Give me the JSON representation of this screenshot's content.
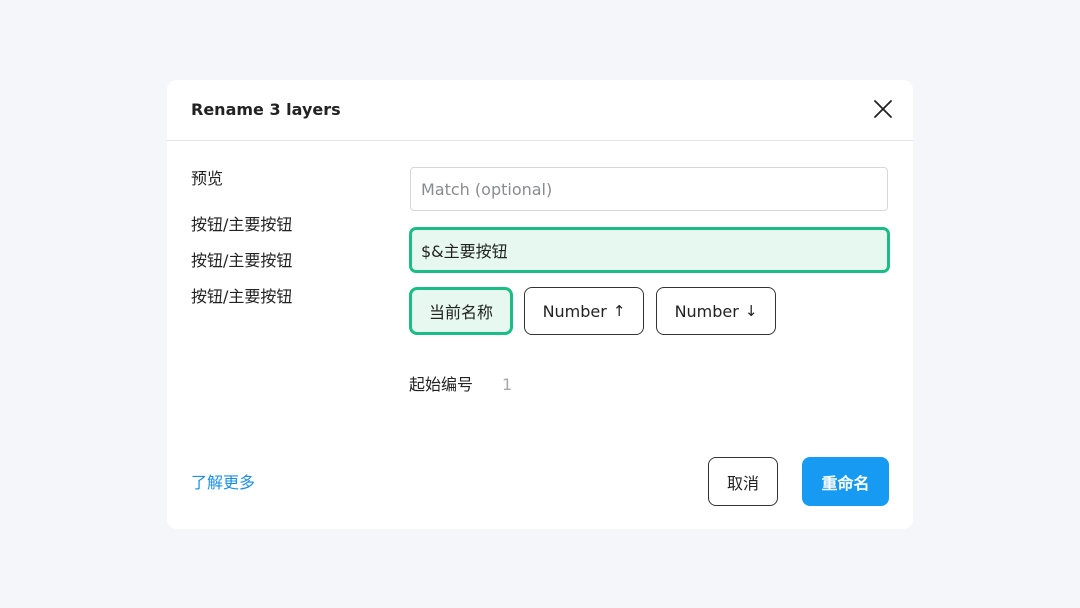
{
  "dialog": {
    "title": "Rename 3 layers"
  },
  "icons": {
    "close": "close-icon"
  },
  "preview": {
    "label": "预览",
    "items": [
      "按钮/主要按钮",
      "按钮/主要按钮",
      "按钮/主要按钮"
    ]
  },
  "match_input": {
    "value": "",
    "placeholder": "Match (optional)"
  },
  "rename_input": {
    "value": "$&主要按钮"
  },
  "tokens": {
    "current_name": "当前名称",
    "number_asc_label": "Number",
    "number_asc_arrow": "↑",
    "number_desc_label": "Number",
    "number_desc_arrow": "↓"
  },
  "start_number": {
    "label": "起始编号",
    "value": "1"
  },
  "footer": {
    "learn_more": "了解更多",
    "cancel": "取消",
    "confirm": "重命名"
  },
  "colors": {
    "accent_green": "#1bbd86",
    "accent_green_bg": "#e6f8ef",
    "primary_blue": "#169af2",
    "link_blue": "#1d8fe0",
    "page_bg": "#f5f6fa"
  }
}
